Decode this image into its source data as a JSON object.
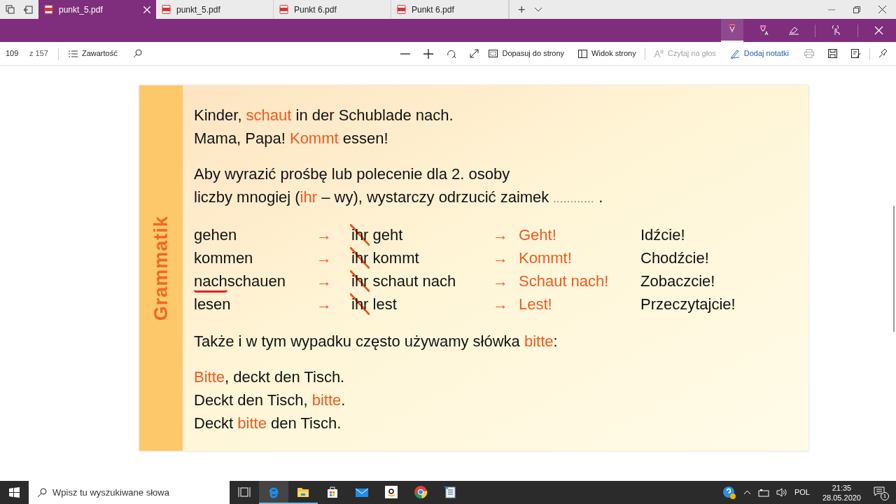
{
  "tabs": [
    {
      "label": "punkt_5.pdf",
      "selected": true
    },
    {
      "label": "punkt_5.pdf",
      "selected": false
    },
    {
      "label": "Punkt 6.pdf",
      "selected": false
    },
    {
      "label": "Punkt 6.pdf",
      "selected": false
    }
  ],
  "new_tab": "+",
  "ink_toolbar": {
    "tools": [
      {
        "kind": "pen",
        "selected": true
      },
      {
        "kind": "highlighter",
        "selected": false
      },
      {
        "kind": "eraser",
        "selected": false
      },
      {
        "kind": "touch",
        "selected": false
      },
      {
        "kind": "close",
        "selected": false
      }
    ]
  },
  "toolbar": {
    "page": "109",
    "page_count": "z 157",
    "contents": "Zawartość",
    "fit": "Dopasuj do strony",
    "page_view": "Widok strony",
    "read_aloud": {
      "label": "Czytaj na głos",
      "disabled": true
    },
    "add_notes": "Dodaj notatki"
  },
  "document": {
    "side_label": "Grammatik",
    "intro": [
      [
        {
          "text": "Kinder, ",
          "hl": false
        },
        {
          "text": "schaut",
          "hl": true
        },
        {
          "text": " in der Schublade nach.",
          "hl": false
        }
      ],
      [
        {
          "text": "Mama, Papa! ",
          "hl": false
        },
        {
          "text": "Kommt",
          "hl": true
        },
        {
          "text": " essen!",
          "hl": false
        }
      ]
    ],
    "rule": [
      [
        {
          "text": "Aby wyrazić prośbę lub polecenie dla 2. osoby",
          "hl": false
        }
      ],
      [
        {
          "text": "liczby mnogiej (",
          "hl": false
        },
        {
          "text": "ihr",
          "hl": true
        },
        {
          "text": " – wy), wystarczy odrzucić zaimek ",
          "hl": false
        },
        {
          "text": "............",
          "dots": true
        },
        {
          "text": " .",
          "hl": false
        }
      ]
    ],
    "rows": [
      {
        "verb": [
          {
            "text": "gehen",
            "underlined": false
          }
        ],
        "arrow": "→",
        "pronoun": "ihr",
        "form": "geht",
        "arrow2": "→",
        "imperative": "Geht!",
        "translation": "Idźcie!"
      },
      {
        "verb": [
          {
            "text": "kommen",
            "underlined": false
          }
        ],
        "arrow": "→",
        "pronoun": "ihr",
        "form": "kommt",
        "arrow2": "→",
        "imperative": "Kommt!",
        "translation": "Chodźcie!"
      },
      {
        "verb": [
          {
            "text": "nach",
            "underlined": true
          },
          {
            "text": "schauen",
            "underlined": false
          }
        ],
        "arrow": "→",
        "pronoun": "ihr",
        "form": "schaut nach",
        "arrow2": "→",
        "imperative": "Schaut nach!",
        "translation": "Zobaczcie!"
      },
      {
        "verb": [
          {
            "text": "lesen",
            "underlined": false
          }
        ],
        "arrow": "→",
        "pronoun": "ihr",
        "form": "lest",
        "arrow2": "→",
        "imperative": "Lest!",
        "translation": "Przeczytajcie!"
      }
    ],
    "note": [
      [
        {
          "text": "Także i w tym wypadku często używamy słówka ",
          "hl": false
        },
        {
          "text": "bitte",
          "hl": true
        },
        {
          "text": ":",
          "hl": false
        }
      ]
    ],
    "examples": [
      [
        {
          "text": "Bitte",
          "hl": true
        },
        {
          "text": ", deckt den Tisch.",
          "hl": false
        }
      ],
      [
        {
          "text": "Deckt den Tisch, ",
          "hl": false
        },
        {
          "text": "bitte",
          "hl": true
        },
        {
          "text": ".",
          "hl": false
        }
      ],
      [
        {
          "text": "Deckt ",
          "hl": false
        },
        {
          "text": "bitte",
          "hl": true
        },
        {
          "text": " den Tisch.",
          "hl": false
        }
      ]
    ]
  },
  "taskbar": {
    "search_placeholder": "Wpisz tu wyszukiwane słowa",
    "apps": [
      {
        "kind": "taskview",
        "active": false
      },
      {
        "kind": "edge",
        "active": true
      },
      {
        "kind": "explorer",
        "active": true
      },
      {
        "kind": "store",
        "active": false
      },
      {
        "kind": "mail",
        "active": false
      },
      {
        "kind": "amazon",
        "active": false
      },
      {
        "kind": "chrome",
        "active": false
      },
      {
        "kind": "notes",
        "active": false
      }
    ],
    "language": "POL",
    "time": "21:35",
    "date": "28.05.2020",
    "notifications": "1"
  }
}
